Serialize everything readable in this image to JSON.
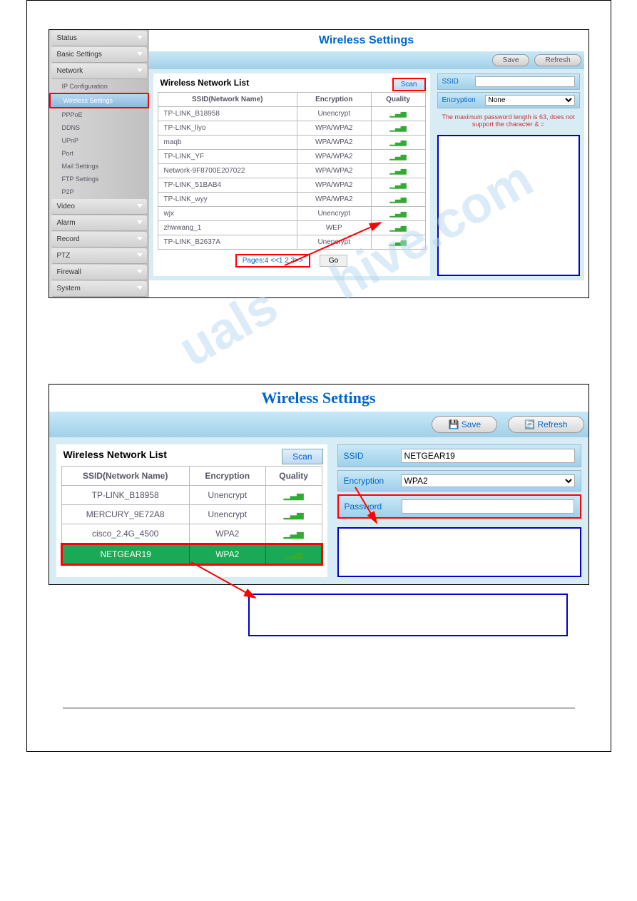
{
  "sidebar": {
    "items": [
      "Status",
      "Basic Settings",
      "Network",
      "Video",
      "Alarm",
      "Record",
      "PTZ",
      "Firewall",
      "System"
    ],
    "network_subs": [
      "IP Configuration",
      "Wireless Settings",
      "PPPoE",
      "DDNS",
      "UPnP",
      "Port",
      "Mail Settings",
      "FTP Settings",
      "P2P"
    ],
    "active_sub": "Wireless Settings"
  },
  "s1": {
    "title": "Wireless Settings",
    "save": "Save",
    "refresh": "Refresh",
    "wnl_title": "Wireless Network List",
    "scan": "Scan",
    "cols": [
      "SSID(Network Name)",
      "Encryption",
      "Quality"
    ],
    "rows": [
      {
        "ssid": "TP-LINK_B18958",
        "enc": "Unencrypt"
      },
      {
        "ssid": "TP-LINK_liyo",
        "enc": "WPA/WPA2"
      },
      {
        "ssid": "maqb",
        "enc": "WPA/WPA2"
      },
      {
        "ssid": "TP-LINK_YF",
        "enc": "WPA/WPA2"
      },
      {
        "ssid": "Network-9F8700E207022",
        "enc": "WPA/WPA2"
      },
      {
        "ssid": "TP-LINK_51BAB4",
        "enc": "WPA/WPA2"
      },
      {
        "ssid": "TP-LINK_wyy",
        "enc": "WPA/WPA2"
      },
      {
        "ssid": "wjx",
        "enc": "Unencrypt"
      },
      {
        "ssid": "zhwwang_1",
        "enc": "WEP"
      },
      {
        "ssid": "TP-LINK_B2637A",
        "enc": "Unencrypt"
      }
    ],
    "pager": "Pages:4    <<1 2 3>>",
    "go": "Go",
    "ssid_label": "SSID",
    "enc_label": "Encryption",
    "enc_value": "None",
    "hint": "The maximum password length is 63, does not support the character & ="
  },
  "s2": {
    "title": "Wireless Settings",
    "save": "Save",
    "refresh": "Refresh",
    "wnl_title": "Wireless Network List",
    "scan": "Scan",
    "cols": [
      "SSID(Network Name)",
      "Encryption",
      "Quality"
    ],
    "rows": [
      {
        "ssid": "TP-LINK_B18958",
        "enc": "Unencrypt",
        "sel": false
      },
      {
        "ssid": "MERCURY_9E72A8",
        "enc": "Unencrypt",
        "sel": false
      },
      {
        "ssid": "cisco_2.4G_4500",
        "enc": "WPA2",
        "sel": false
      },
      {
        "ssid": "NETGEAR19",
        "enc": "WPA2",
        "sel": true
      }
    ],
    "ssid_label": "SSID",
    "ssid_value": "NETGEAR19",
    "enc_label": "Encryption",
    "enc_value": "WPA2",
    "pwd_label": "Password",
    "pwd_value": ""
  }
}
